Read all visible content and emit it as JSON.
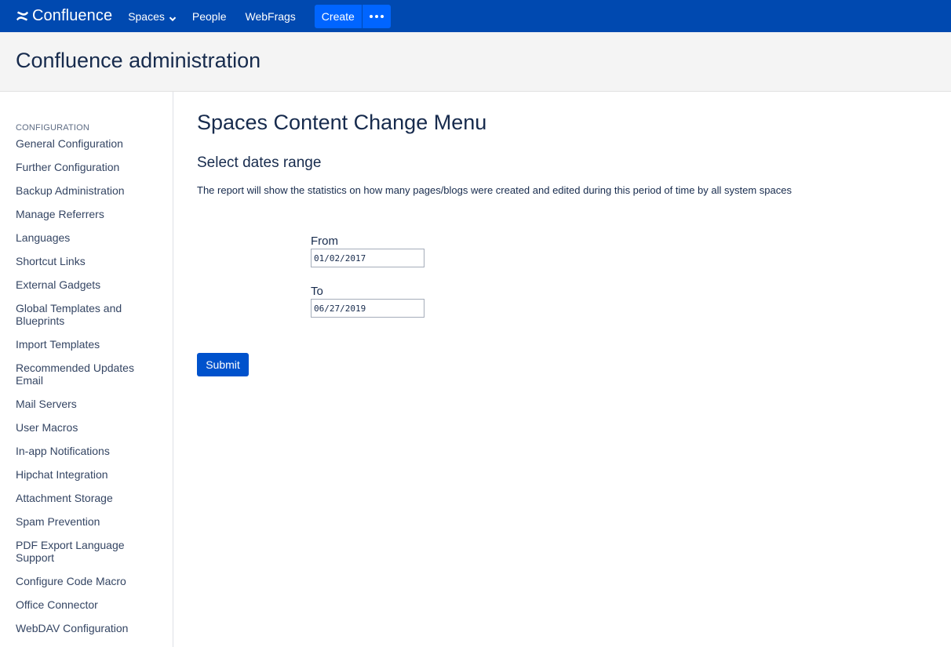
{
  "nav": {
    "logo_text": "Confluence",
    "spaces_label": "Spaces",
    "people_label": "People",
    "webfrags_label": "WebFrags",
    "create_label": "Create",
    "brand_color": "#0049b0",
    "accent_color": "#0065ff"
  },
  "admin_header": {
    "title": "Confluence administration"
  },
  "sidebar": {
    "heading": "CONFIGURATION",
    "items": [
      {
        "label": "General Configuration"
      },
      {
        "label": "Further Configuration"
      },
      {
        "label": "Backup Administration"
      },
      {
        "label": "Manage Referrers"
      },
      {
        "label": "Languages"
      },
      {
        "label": "Shortcut Links"
      },
      {
        "label": "External Gadgets"
      },
      {
        "label": "Global Templates and Blueprints"
      },
      {
        "label": "Import Templates"
      },
      {
        "label": "Recommended Updates Email"
      },
      {
        "label": "Mail Servers"
      },
      {
        "label": "User Macros"
      },
      {
        "label": "In-app Notifications"
      },
      {
        "label": "Hipchat Integration"
      },
      {
        "label": "Attachment Storage"
      },
      {
        "label": "Spam Prevention"
      },
      {
        "label": "PDF Export Language Support"
      },
      {
        "label": "Configure Code Macro"
      },
      {
        "label": "Office Connector"
      },
      {
        "label": "WebDAV Configuration"
      }
    ]
  },
  "main": {
    "page_title": "Spaces Content Change Menu",
    "section_title": "Select dates range",
    "description": "The report will show the statistics on how many pages/blogs were created and edited during this period of time by all system spaces",
    "from_label": "From",
    "from_value": "01/02/2017",
    "to_label": "To",
    "to_value": "06/27/2019",
    "submit_label": "Submit"
  }
}
